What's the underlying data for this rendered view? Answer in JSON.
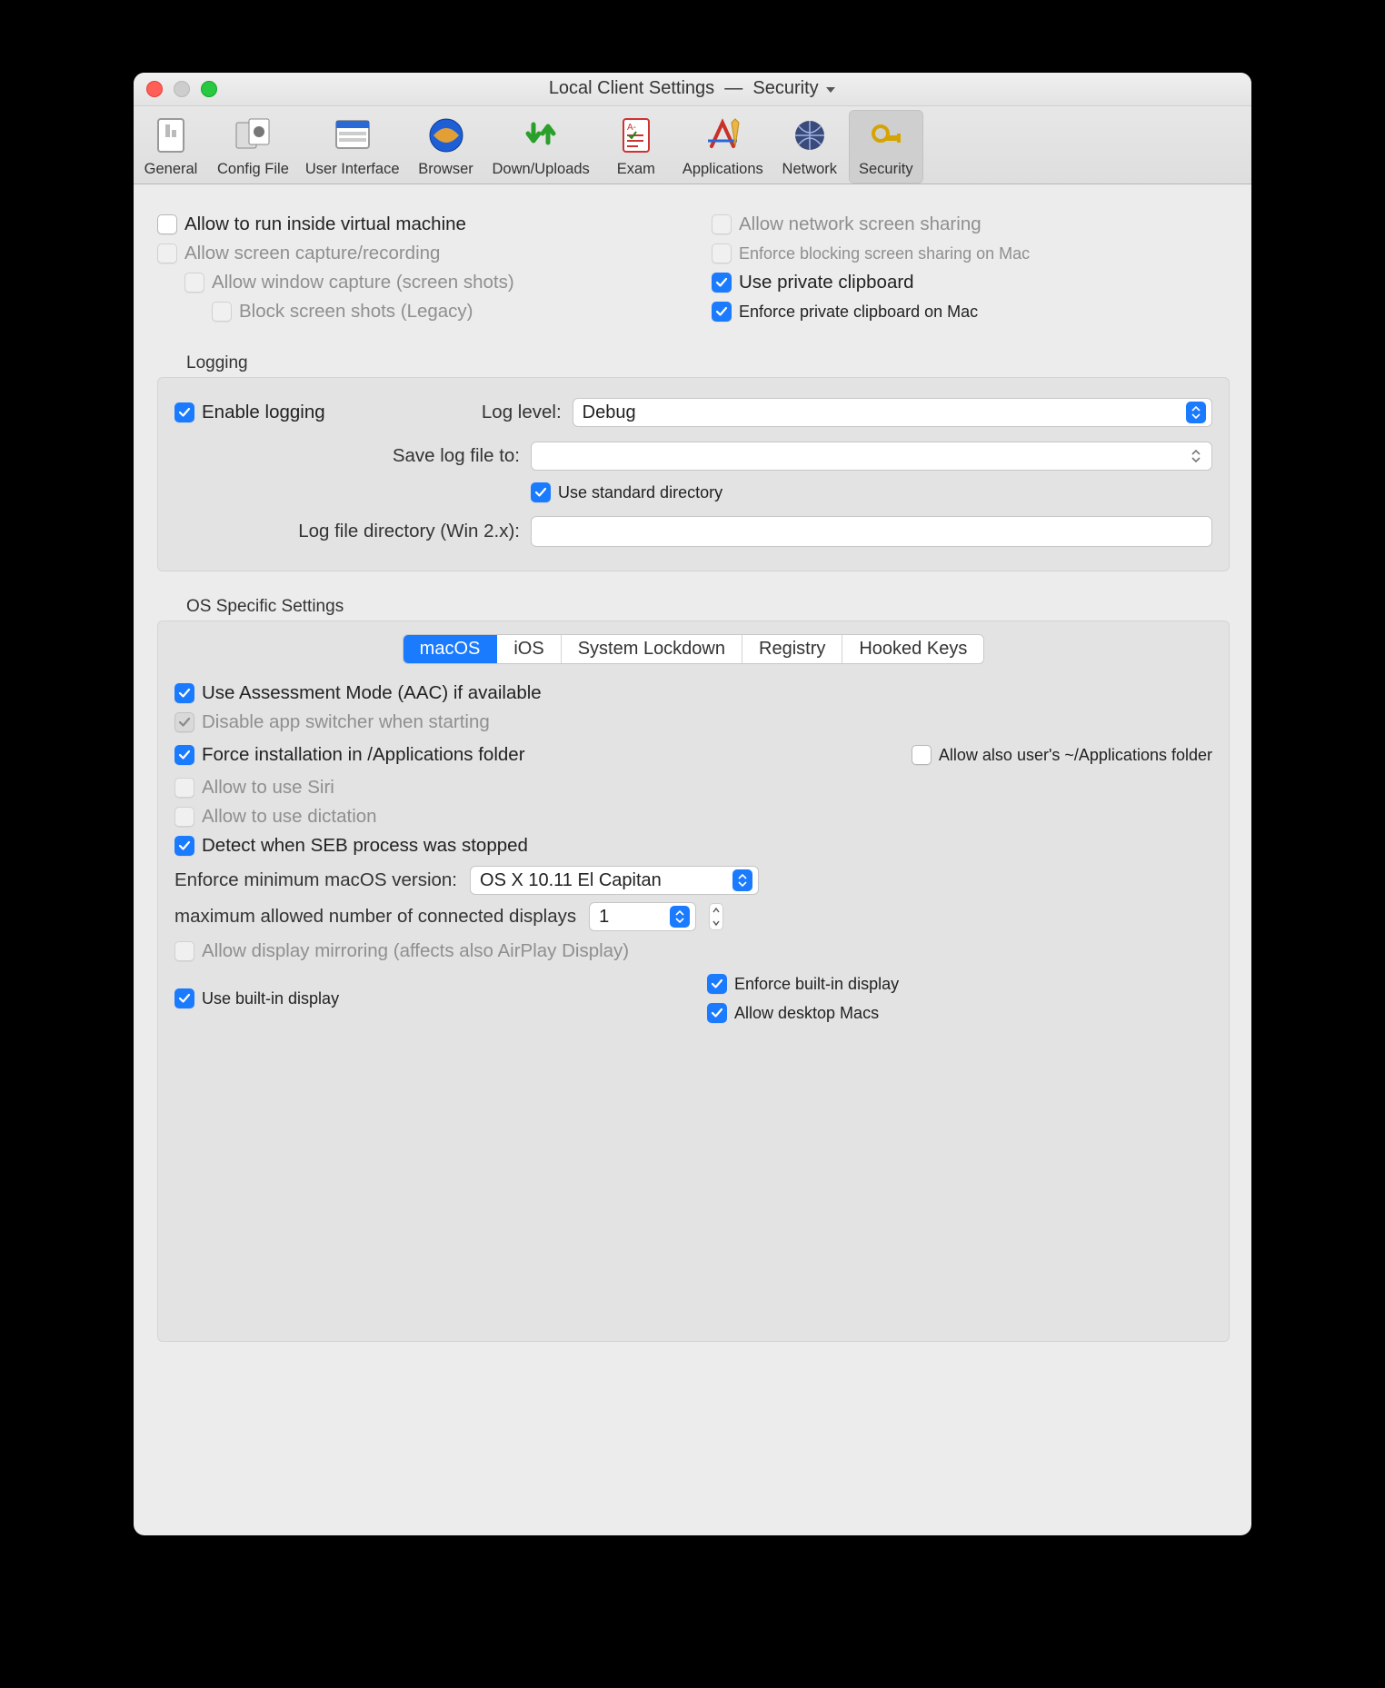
{
  "title": {
    "main": "Local Client Settings",
    "section": "Security"
  },
  "toolbar": [
    {
      "name": "general",
      "label": "General"
    },
    {
      "name": "config-file",
      "label": "Config File"
    },
    {
      "name": "user-interface",
      "label": "User Interface"
    },
    {
      "name": "browser",
      "label": "Browser"
    },
    {
      "name": "down-uploads",
      "label": "Down/Uploads"
    },
    {
      "name": "exam",
      "label": "Exam"
    },
    {
      "name": "applications",
      "label": "Applications"
    },
    {
      "name": "network",
      "label": "Network"
    },
    {
      "name": "security",
      "label": "Security"
    }
  ],
  "top": {
    "left": [
      {
        "key": "allow_vm",
        "label": "Allow to run inside virtual machine",
        "checked": false,
        "disabled": false,
        "indent": 0
      },
      {
        "key": "allow_capture",
        "label": "Allow screen capture/recording",
        "checked": false,
        "disabled": true,
        "indent": 0
      },
      {
        "key": "allow_window_capture",
        "label": "Allow window capture (screen shots)",
        "checked": false,
        "disabled": true,
        "indent": 1
      },
      {
        "key": "block_screenshots",
        "label": "Block screen shots (Legacy)",
        "checked": false,
        "disabled": true,
        "indent": 2
      }
    ],
    "right": [
      {
        "key": "allow_net_screen",
        "label": "Allow network screen sharing",
        "checked": false,
        "disabled": true
      },
      {
        "key": "enforce_block_mac",
        "label": "Enforce blocking screen sharing on Mac",
        "checked": false,
        "disabled": true,
        "small": true
      },
      {
        "key": "private_clip",
        "label": "Use private clipboard",
        "checked": true,
        "disabled": false
      },
      {
        "key": "enforce_clip_mac",
        "label": "Enforce private clipboard on Mac",
        "checked": true,
        "disabled": false,
        "small": true
      }
    ]
  },
  "logging": {
    "title": "Logging",
    "enable": {
      "label": "Enable logging",
      "checked": true
    },
    "loglevel_label": "Log level:",
    "loglevel_value": "Debug",
    "savefile_label": "Save log file to:",
    "savefile_value": "",
    "use_std": {
      "label": "Use standard directory",
      "checked": true
    },
    "logdir_label": "Log file directory (Win 2.x):",
    "logdir_value": ""
  },
  "os": {
    "title": "OS Specific Settings",
    "tabs": [
      "macOS",
      "iOS",
      "System Lockdown",
      "Registry",
      "Hooked Keys"
    ],
    "selected_tab": "macOS",
    "items": {
      "use_aac": {
        "label": "Use Assessment Mode (AAC) if available",
        "checked": true,
        "disabled": false
      },
      "disable_switcher": {
        "label": "Disable app switcher when starting",
        "checked": true,
        "disabled": true
      },
      "force_install": {
        "label": "Force installation in /Applications folder",
        "checked": true,
        "disabled": false
      },
      "allow_user_apps": {
        "label": "Allow also user's ~/Applications folder",
        "checked": false,
        "disabled": false
      },
      "allow_siri": {
        "label": "Allow to use Siri",
        "checked": false,
        "disabled": true
      },
      "allow_dictation": {
        "label": "Allow to use dictation",
        "checked": false,
        "disabled": true
      },
      "detect_stopped": {
        "label": "Detect when SEB process was stopped",
        "checked": true,
        "disabled": false
      },
      "enforce_min_label": "Enforce minimum macOS version:",
      "enforce_min_value": "OS X 10.11 El Capitan",
      "max_displays_label": "maximum allowed number of connected displays",
      "max_displays_value": "1",
      "allow_mirror": {
        "label": "Allow display mirroring (affects also AirPlay Display)",
        "checked": false,
        "disabled": true
      },
      "use_builtin": {
        "label": "Use built-in display",
        "checked": true,
        "disabled": false
      },
      "enforce_builtin": {
        "label": "Enforce built-in display",
        "checked": true,
        "disabled": false
      },
      "allow_desktop_macs": {
        "label": "Allow desktop Macs",
        "checked": true,
        "disabled": false
      }
    }
  }
}
